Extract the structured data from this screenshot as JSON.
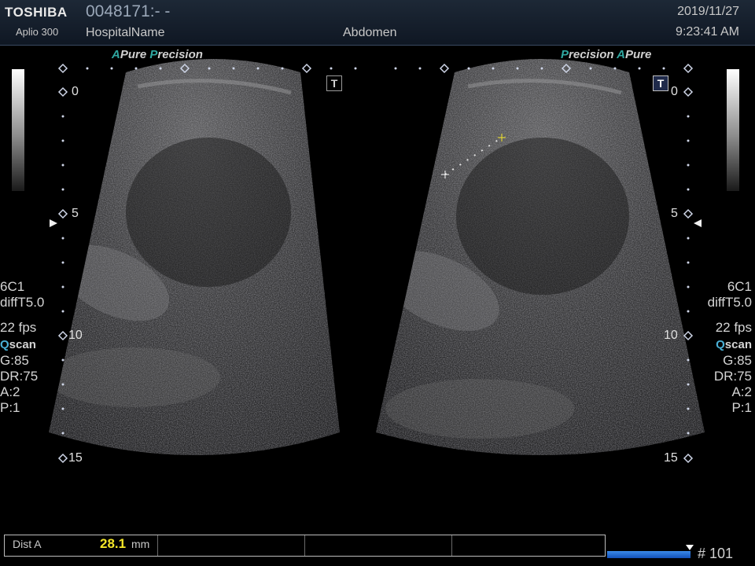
{
  "header": {
    "brand": "TOSHIBA",
    "model": "Aplio 300",
    "patient_id": "0048171:- -",
    "hospital": "HospitalName",
    "preset": "Abdomen",
    "date": "2019/11/27",
    "time": "9:23:41 AM"
  },
  "left_image": {
    "mode_tags": {
      "a": "A",
      "pure": "Pure",
      "p": "P",
      "precision": "recision"
    },
    "depth_labels": [
      "0",
      "5",
      "10",
      "15"
    ]
  },
  "right_image": {
    "mode_tags": {
      "p": "P",
      "precision": "recision",
      "a": "A",
      "pure": "Pure"
    },
    "depth_labels": [
      "0",
      "5",
      "10",
      "15"
    ]
  },
  "left_panel": {
    "probe": "6C1",
    "filter": "diffT5.0",
    "fps": "22 fps",
    "qscan_q": "Q",
    "qscan_rest": "scan",
    "gain": "G:85",
    "dynamic_range": "DR:75",
    "a": "A:2",
    "p": "P:1"
  },
  "right_panel": {
    "probe": "6C1",
    "filter": "diffT5.0",
    "fps": "22 fps",
    "qscan_q": "Q",
    "qscan_rest": "scan",
    "gain": "G:85",
    "dynamic_range": "DR:75",
    "a": "A:2",
    "p": "P:1"
  },
  "icons": {
    "left_t": "T",
    "right_t": "T"
  },
  "measurement": {
    "name": "Dist A",
    "value": "28.1",
    "unit": "mm"
  },
  "cine": {
    "frame": "# 101",
    "progress": 1.0
  }
}
